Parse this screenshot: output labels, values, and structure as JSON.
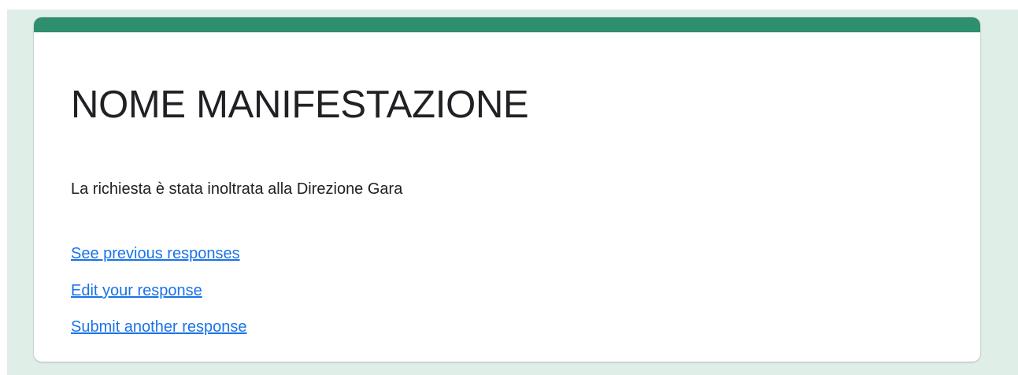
{
  "colors": {
    "background": "#dfeee6",
    "accent": "#2d8f6e",
    "link": "#1a73e8",
    "text": "#202124"
  },
  "form": {
    "title": "NOME MANIFESTAZIONE",
    "confirmation_message": "La richiesta è stata inoltrata alla Direzione Gara",
    "links": {
      "see_previous": "See previous responses",
      "edit_response": "Edit your response",
      "submit_another": "Submit another response"
    }
  }
}
